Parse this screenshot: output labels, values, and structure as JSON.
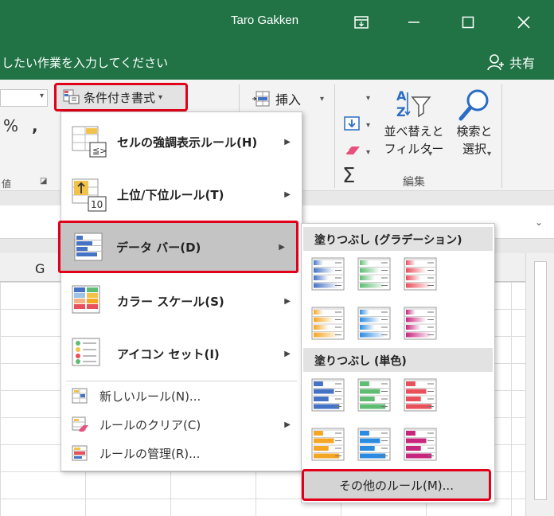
{
  "window": {
    "user_name": "Taro Gakken",
    "tell_me_placeholder": "したい作業を入力してください",
    "share_label": "共有"
  },
  "ribbon": {
    "conditional_format_label": "条件付き書式",
    "percent_symbol": "%",
    "comma_symbol": ",",
    "left_group_label": "値",
    "insert_label": "挿入",
    "sum_symbol": "Σ",
    "sort_filter_line1": "並べ替えと",
    "sort_filter_line2": "フィルター",
    "find_select_line1": "検索と",
    "find_select_line2": "選択",
    "edit_group_label": "編集"
  },
  "sheet": {
    "column_g": "G"
  },
  "menu": {
    "items": [
      {
        "label": "セルの強調表示ルール(H)",
        "icon": "highlight-rules-icon"
      },
      {
        "label": "上位/下位ルール(T)",
        "icon": "top-bottom-rules-icon"
      },
      {
        "label": "データ バー(D)",
        "icon": "data-bars-icon"
      },
      {
        "label": "カラー スケール(S)",
        "icon": "color-scales-icon"
      },
      {
        "label": "アイコン セット(I)",
        "icon": "icon-sets-icon"
      }
    ],
    "small_items": [
      {
        "label": "新しいルール(N)...",
        "icon": "new-rule-icon"
      },
      {
        "label": "ルールのクリア(C)",
        "icon": "clear-rules-icon"
      },
      {
        "label": "ルールの管理(R)...",
        "icon": "manage-rules-icon"
      }
    ]
  },
  "submenu": {
    "gradient_header": "塗りつぶし (グラデーション)",
    "solid_header": "塗りつぶし (単色)",
    "more_rules": "その他のルール(M)...",
    "colors": {
      "blue": "#4472c4",
      "green": "#5fbd73",
      "red": "#e8505b",
      "orange": "#f5a623",
      "lightblue": "#2b8be0",
      "purple": "#c7267d"
    }
  }
}
